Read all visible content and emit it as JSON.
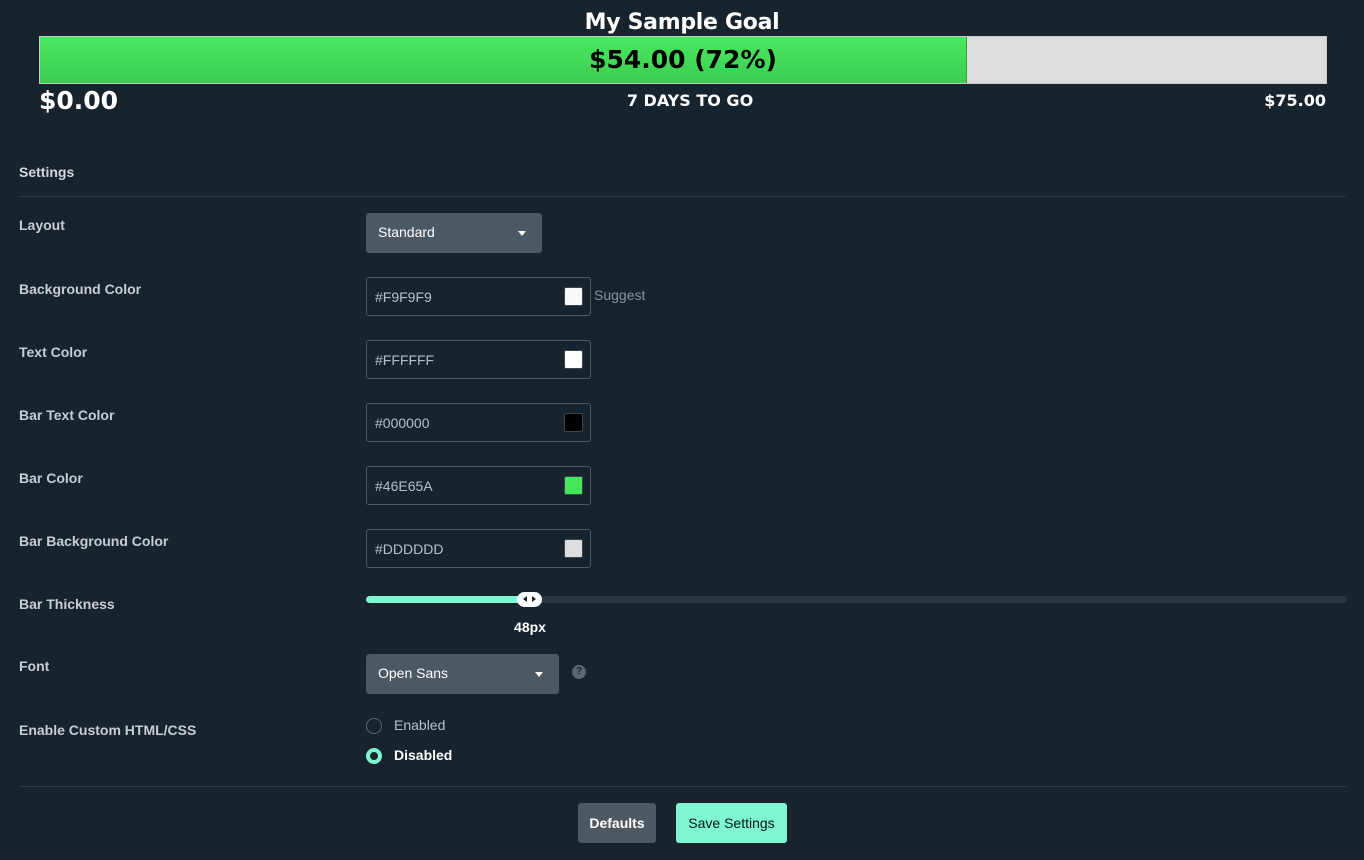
{
  "goal": {
    "title": "My Sample Goal",
    "bar_label": "$54.00 (72%)",
    "progress": 0.72,
    "start_amount": "$0.00",
    "days_left": "7 DAYS TO GO",
    "end_amount": "$75.00",
    "bar_color": "#46E65A",
    "bar_background_color": "#DDDDDD"
  },
  "settings": {
    "section_title": "Settings",
    "layout": {
      "label": "Layout",
      "value": "Standard"
    },
    "background_color": {
      "label": "Background Color",
      "value": "#F9F9F9",
      "suggest_label": "Suggest"
    },
    "text_color": {
      "label": "Text Color",
      "value": "#FFFFFF"
    },
    "bar_text_color": {
      "label": "Bar Text Color",
      "value": "#000000"
    },
    "bar_color": {
      "label": "Bar Color",
      "value": "#46E65A"
    },
    "bar_background_color": {
      "label": "Bar Background Color",
      "value": "#DDDDDD"
    },
    "bar_thickness": {
      "label": "Bar Thickness",
      "value_label": "48px",
      "slider_fraction": 0.167
    },
    "font": {
      "label": "Font",
      "value": "Open Sans",
      "help_icon": "question-circle-icon"
    },
    "custom_html": {
      "label": "Enable Custom HTML/CSS",
      "options": [
        {
          "label": "Enabled",
          "checked": false
        },
        {
          "label": "Disabled",
          "checked": true
        }
      ]
    }
  },
  "actions": {
    "defaults_label": "Defaults",
    "save_label": "Save Settings"
  },
  "colors": {
    "accent": "#80F5D2",
    "background": "#17242D",
    "control": "#4C5963"
  }
}
